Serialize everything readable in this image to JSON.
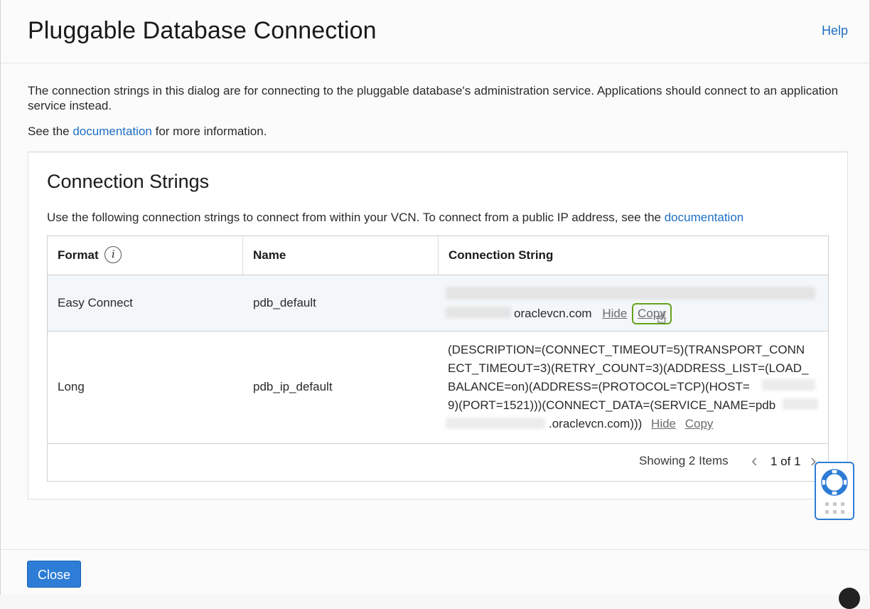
{
  "dialog": {
    "title": "Pluggable Database Connection",
    "help_label": "Help",
    "intro_text": "The connection strings in this dialog are for connecting to the pluggable database's administration service. Applications should connect to an application service instead.",
    "see_prefix": "See the",
    "see_link": "documentation",
    "see_suffix": "for more information."
  },
  "panel": {
    "title": "Connection Strings",
    "desc_prefix": "Use the following connection strings to connect from within your VCN. To connect from a public IP address, see the",
    "desc_link": "documentation"
  },
  "table": {
    "headers": {
      "format": "Format",
      "name": "Name",
      "connection_string": "Connection String"
    },
    "info_icon_glyph": "i",
    "rows": [
      {
        "format": "Easy Connect",
        "name": "pdb_default",
        "conn_visible_tail": "oraclevcn.com",
        "hide_label": "Hide",
        "copy_label": "Copy"
      },
      {
        "format": "Long",
        "name": "pdb_ip_default",
        "conn_line1": "(DESCRIPTION=(CONNECT_TIMEOUT=5)(TRANSPORT_CONN",
        "conn_line2": "ECT_TIMEOUT=3)(RETRY_COUNT=3)(ADDRESS_LIST=(LOAD_",
        "conn_line3": "BALANCE=on)(ADDRESS=(PROTOCOL=TCP)(HOST=",
        "conn_line4": "9)(PORT=1521)))(CONNECT_DATA=(SERVICE_NAME=pdb",
        "conn_line5": ".oraclevcn.com)))",
        "hide_label": "Hide",
        "copy_label": "Copy"
      }
    ],
    "footer": {
      "showing": "Showing 2 Items",
      "page": "1 of 1",
      "prev_glyph": "‹",
      "next_glyph": "›"
    }
  },
  "buttons": {
    "close_label": "Close"
  },
  "icons": {
    "info": "info-icon",
    "support": "lifebuoy-icon",
    "grid": "grid-dots-icon",
    "cursor": "hand-pointer-icon",
    "prev": "chevron-left-icon",
    "next": "chevron-right-icon"
  },
  "colors": {
    "accent": "#2d7cd6",
    "link": "#1f6fc5",
    "focus_ring": "#64a31a",
    "row_highlight": "#f3f7fa"
  }
}
